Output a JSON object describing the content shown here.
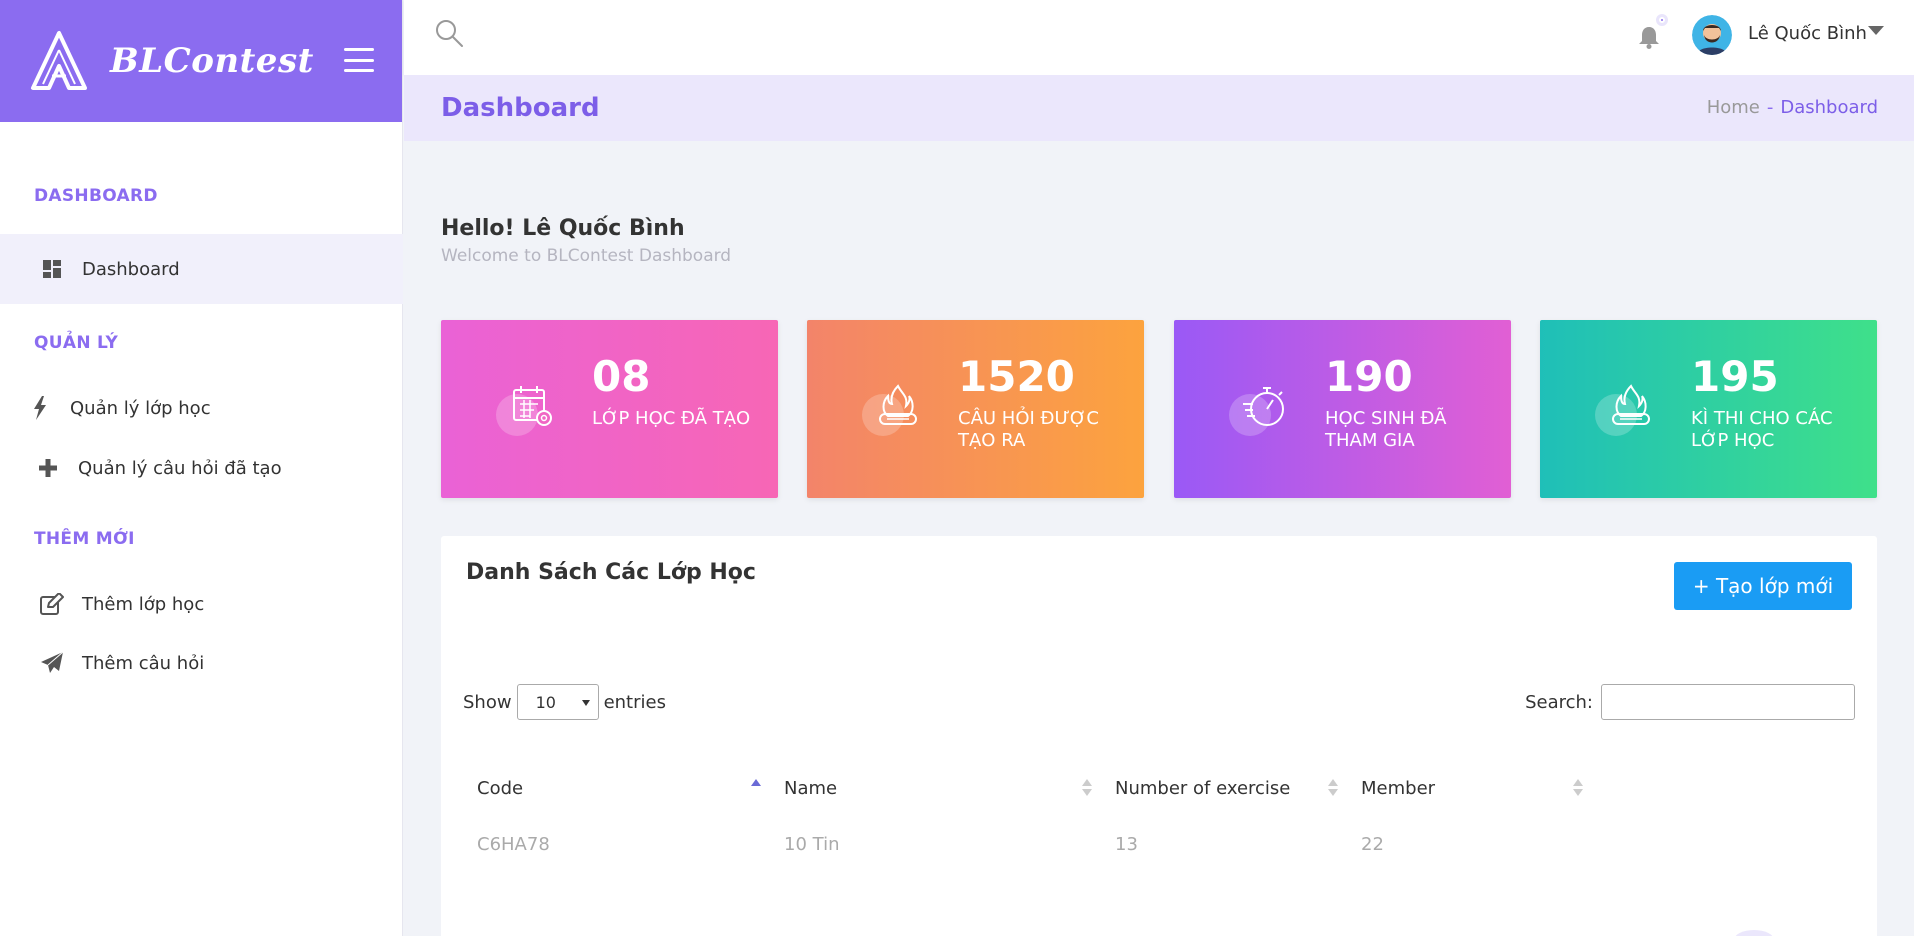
{
  "brand": {
    "name": "BLContest"
  },
  "sidebar": {
    "sections": [
      {
        "title": "DASHBOARD",
        "items": [
          {
            "label": "Dashboard",
            "icon": "dashboard-icon"
          }
        ]
      },
      {
        "title": "QUẢN LÝ",
        "items": [
          {
            "label": "Quản lý lớp học",
            "icon": "bolt-icon"
          },
          {
            "label": "Quản lý câu hỏi đã tạo",
            "icon": "plus-icon"
          }
        ]
      },
      {
        "title": "THÊM MỚI",
        "items": [
          {
            "label": "Thêm lớp học",
            "icon": "edit-icon"
          },
          {
            "label": "Thêm câu hỏi",
            "icon": "paper-plane-icon"
          }
        ]
      }
    ]
  },
  "topbar": {
    "username": "Lê Quốc Bình"
  },
  "page": {
    "title": "Dashboard",
    "breadcrumb": {
      "home": "Home",
      "separator": "-",
      "current": "Dashboard"
    }
  },
  "greeting": {
    "hello": "Hello! Lê Quốc Bình",
    "welcome": "Welcome to BLContest Dashboard"
  },
  "stats": [
    {
      "value": "08",
      "label": "LỚP HỌC ĐÃ TẠO",
      "icon": "calendar-gear-icon"
    },
    {
      "value": "1520",
      "label": "CÂU HỎI ĐƯỢC TẠO RA",
      "icon": "fire-test-icon"
    },
    {
      "value": "190",
      "label": "HỌC SINH ĐÃ THAM GIA",
      "icon": "stopwatch-icon"
    },
    {
      "value": "195",
      "label": "KÌ THI CHO CÁC LỚP HỌC",
      "icon": "fire-test-icon"
    }
  ],
  "colors": {
    "accent": "#8b6cf0",
    "button": "#1a9cf4"
  },
  "table": {
    "title": "Danh Sách Các Lớp Học",
    "new_button": "+ Tạo lớp mới",
    "show_label": "Show",
    "entries_value": "10",
    "entries_label": "entries",
    "search_label": "Search:",
    "search_value": "",
    "columns": [
      "Code",
      "Name",
      "Number of exercise",
      "Member"
    ],
    "rows": [
      {
        "code": "C6HA78",
        "name": "10 Tin",
        "exercises": "13",
        "members": "22"
      }
    ]
  }
}
